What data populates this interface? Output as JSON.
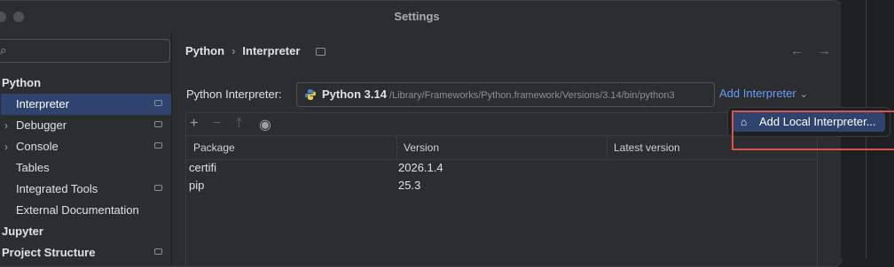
{
  "window": {
    "title": "Settings"
  },
  "sidebar": {
    "items": [
      {
        "label": "Python",
        "bold": true
      },
      {
        "label": "Interpreter",
        "selected": true,
        "badge": true
      },
      {
        "label": "Debugger",
        "expandable": true,
        "badge": true
      },
      {
        "label": "Console",
        "expandable": true,
        "badge": true
      },
      {
        "label": "Tables"
      },
      {
        "label": "Integrated Tools",
        "badge": true
      },
      {
        "label": "External Documentation"
      },
      {
        "label": "Jupyter",
        "bold": true
      },
      {
        "label": "Project Structure",
        "bold": true,
        "badge": true
      }
    ]
  },
  "breadcrumb": {
    "parent": "Python",
    "separator": "›",
    "current": "Interpreter"
  },
  "interpreter": {
    "label": "Python Interpreter:",
    "name": "Python 3.14",
    "path": "/Library/Frameworks/Python.framework/Versions/3.14/bin/python3"
  },
  "add_interpreter": {
    "label": "Add Interpreter",
    "chevron": "⌄"
  },
  "toolbar": {
    "icons": [
      "add-icon",
      "remove-icon",
      "upgrade-icon",
      "eye-icon"
    ]
  },
  "table": {
    "columns": [
      "Package",
      "Version",
      "Latest version"
    ],
    "rows": [
      {
        "package": "certifi",
        "version": "2026.1.4",
        "latest": ""
      },
      {
        "package": "pip",
        "version": "25.3",
        "latest": ""
      }
    ]
  },
  "popup": {
    "item_label": "Add Local Interpreter..."
  },
  "colors": {
    "accent": "#6b9bfa",
    "selection": "#2e436e",
    "highlight": "#d9534f"
  }
}
